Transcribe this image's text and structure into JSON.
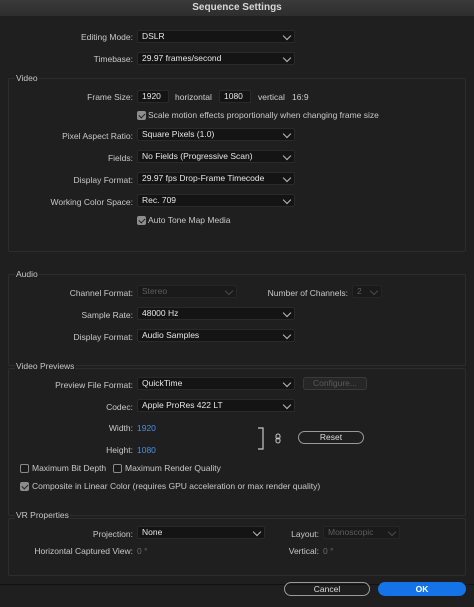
{
  "window": {
    "title": "Sequence Settings"
  },
  "general": {
    "editing_mode_label": "Editing Mode:",
    "editing_mode_value": "DSLR",
    "timebase_label": "Timebase:",
    "timebase_value": "29.97  frames/second"
  },
  "video": {
    "section_title": "Video",
    "frame_size_label": "Frame Size:",
    "width_value": "1920",
    "horizontal_label": "horizontal",
    "height_value": "1080",
    "vertical_label": "vertical",
    "aspect_ratio": "16:9",
    "scale_motion_label": "Scale motion effects proportionally when changing frame size",
    "scale_motion_checked": true,
    "pixel_aspect_label": "Pixel Aspect Ratio:",
    "pixel_aspect_value": "Square Pixels (1.0)",
    "fields_label": "Fields:",
    "fields_value": "No Fields (Progressive Scan)",
    "display_format_label": "Display Format:",
    "display_format_value": "29.97 fps Drop-Frame Timecode",
    "color_space_label": "Working Color Space:",
    "color_space_value": "Rec. 709",
    "auto_tone_label": "Auto Tone Map Media",
    "auto_tone_checked": true
  },
  "audio": {
    "section_title": "Audio",
    "channel_format_label": "Channel Format:",
    "channel_format_value": "Stereo",
    "num_channels_label": "Number of Channels:",
    "num_channels_value": "2",
    "sample_rate_label": "Sample Rate:",
    "sample_rate_value": "48000 Hz",
    "display_format_label": "Display Format:",
    "display_format_value": "Audio Samples"
  },
  "previews": {
    "section_title": "Video Previews",
    "file_format_label": "Preview File Format:",
    "file_format_value": "QuickTime",
    "configure_label": "Configure...",
    "codec_label": "Codec:",
    "codec_value": "Apple ProRes 422 LT",
    "width_label": "Width:",
    "width_value": "1920",
    "height_label": "Height:",
    "height_value": "1080",
    "reset_label": "Reset",
    "max_bit_depth_label": "Maximum Bit Depth",
    "max_bit_depth_checked": false,
    "max_render_label": "Maximum Render Quality",
    "max_render_checked": false,
    "linear_color_label": "Composite in Linear Color (requires GPU acceleration or max render quality)",
    "linear_color_checked": true
  },
  "vr": {
    "section_title": "VR Properties",
    "projection_label": "Projection:",
    "projection_value": "None",
    "layout_label": "Layout:",
    "layout_value": "Monoscopic",
    "h_captured_label": "Horizontal Captured View:",
    "h_captured_value": "0 °",
    "vertical_label": "Vertical:",
    "vertical_value": "0 °"
  },
  "footer": {
    "cancel_label": "Cancel",
    "ok_label": "OK"
  },
  "colors": {
    "accent": "#1473e6",
    "link_blue": "#4a90e2",
    "background": "#1f1f1f"
  }
}
